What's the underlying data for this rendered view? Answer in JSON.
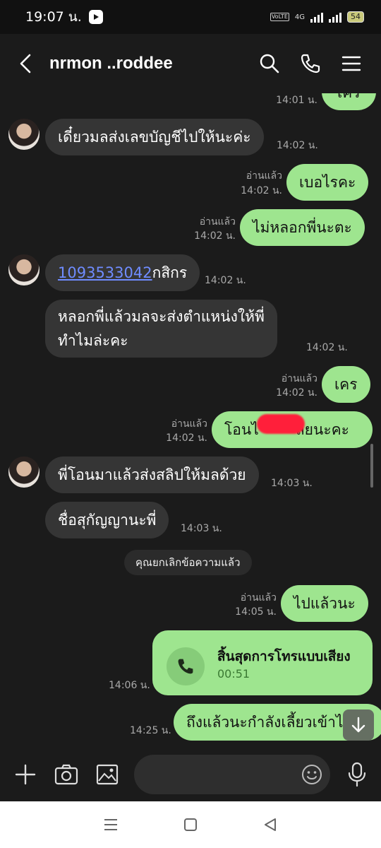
{
  "status_bar": {
    "time": "19:07 น.",
    "network": "4G",
    "battery": "54",
    "volte": "VoLTE"
  },
  "header": {
    "title": "nrmon ..roddee"
  },
  "messages": {
    "m0": {
      "text": "เคร",
      "time": "14:01 น."
    },
    "m1": {
      "text": "เดี๋ยวมลส่งเลขบัญชีไปให้นะค่ะ",
      "time": "14:02 น."
    },
    "m2": {
      "text": "เบอไรคะ",
      "read": "อ่านแล้ว",
      "time": "14:02 น."
    },
    "m3": {
      "text": "ไม่หลอกพี่นะตะ",
      "read": "อ่านแล้ว",
      "time": "14:02 น."
    },
    "m4": {
      "link": "1093533042",
      "text": "กสิกร",
      "time": "14:02 น."
    },
    "m5": {
      "line1": "หลอกพี่แล้วมลจะส่งตำแหน่งให้พี่",
      "line2": "ทำไมล่ะคะ",
      "time": "14:02 น."
    },
    "m6": {
      "text": "เคร",
      "read": "อ่านแล้ว",
      "time": "14:02 น."
    },
    "m7": {
      "text_a": "โอนไ",
      "text_b": "ลยนะคะ",
      "read": "อ่านแล้ว",
      "time": "14:02 น."
    },
    "m8": {
      "text": "พี่โอนมาแล้วส่งสลิปให้มลด้วย",
      "time": "14:03 น."
    },
    "m9": {
      "text": "ชื่อสุกัญญานะพี่",
      "time": "14:03 น."
    },
    "system": {
      "text": "คุณยกเลิกข้อความแล้ว"
    },
    "m10": {
      "text": "ไปแล้วนะ",
      "read": "อ่านแล้ว",
      "time": "14:05 น."
    },
    "call": {
      "title": "สิ้นสุดการโทรแบบเสียง",
      "duration": "00:51",
      "time": "14:06 น."
    },
    "m11": {
      "text": "ถึงแล้วนะกำลังเลี้ยวเข้าไ",
      "time": "14:25 น."
    }
  },
  "colors": {
    "outgoing": "#9ee58f",
    "incoming": "#353535",
    "background": "#1b1b1b",
    "link": "#6f8cff"
  }
}
